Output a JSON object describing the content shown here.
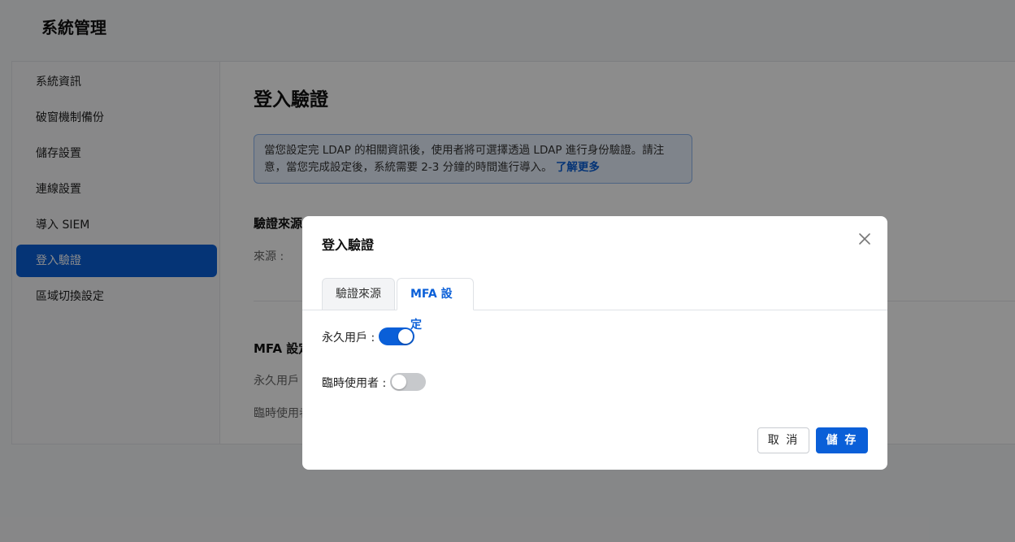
{
  "app": {
    "title": "系統管理"
  },
  "sidebar": {
    "items": [
      {
        "label": "系統資訊",
        "active": false
      },
      {
        "label": "破窗機制備份",
        "active": false
      },
      {
        "label": "儲存設置",
        "active": false
      },
      {
        "label": "連線設置",
        "active": false
      },
      {
        "label": "導入 SIEM",
        "active": false
      },
      {
        "label": "登入驗證",
        "active": true
      },
      {
        "label": "區域切換設定",
        "active": false
      }
    ]
  },
  "main": {
    "title": "登入驗證",
    "info": {
      "text": "當您設定完 LDAP 的相關資訊後，使用者將可選擇透過 LDAP 進行身份驗證。請注意，當您完成設定後，系統需要 2-3 分鐘的時間進行導入。",
      "link": "了解更多"
    },
    "auth_source_title": "驗證來源",
    "source_label": "來源 :",
    "mfa_title": "MFA 設定",
    "permanent_label": "永久用戶 :",
    "temporary_label": "臨時使用者 :"
  },
  "modal": {
    "title": "登入驗證",
    "tabs": [
      {
        "label": "驗證來源",
        "active": false
      },
      {
        "label": "MFA 設定",
        "active": true
      }
    ],
    "permanent_user": {
      "label": "永久用戶 :",
      "enabled": true
    },
    "temporary_user": {
      "label": "臨時使用者 :",
      "enabled": false
    },
    "cancel_label": "取 消",
    "save_label": "儲 存"
  },
  "colors": {
    "accent": "#0a5fd8",
    "toggle_off": "#c7c9cc",
    "info_bg": "#e8f1fd",
    "info_border": "#8fb7ee"
  }
}
